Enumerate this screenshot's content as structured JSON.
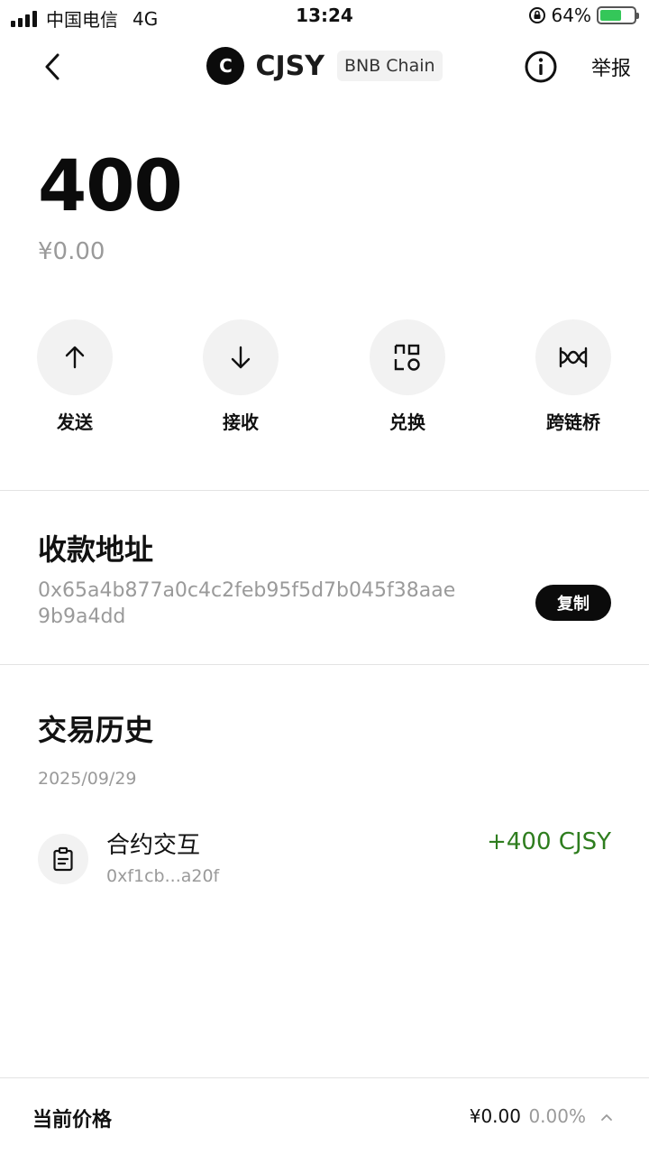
{
  "status_bar": {
    "carrier": "中国电信",
    "network": "4G",
    "time": "13:24",
    "battery": "64%",
    "battery_level": 0.64
  },
  "header": {
    "logo_letter": "C",
    "symbol": "CJSY",
    "chain": "BNB Chain",
    "report_label": "举报"
  },
  "balance": {
    "amount": "400",
    "fiat": "¥0.00"
  },
  "actions": [
    {
      "label": "发送"
    },
    {
      "label": "接收"
    },
    {
      "label": "兑换"
    },
    {
      "label": "跨链桥"
    }
  ],
  "address": {
    "title": "收款地址",
    "value": "0x65a4b877a0c4c2feb95f5d7b045f38aae9b9a4dd",
    "copy_label": "复制"
  },
  "history": {
    "title": "交易历史",
    "date": "2025/09/29",
    "items": [
      {
        "type": "合约交互",
        "hash": "0xf1cb...a20f",
        "amount": "+400 CJSY"
      }
    ]
  },
  "price_bar": {
    "label": "当前价格",
    "value": "¥0.00",
    "change": "0.00%"
  },
  "colors": {
    "positive": "#2e7d1e",
    "muted": "#9a9a9a",
    "chip_bg": "#f2f2f2"
  }
}
